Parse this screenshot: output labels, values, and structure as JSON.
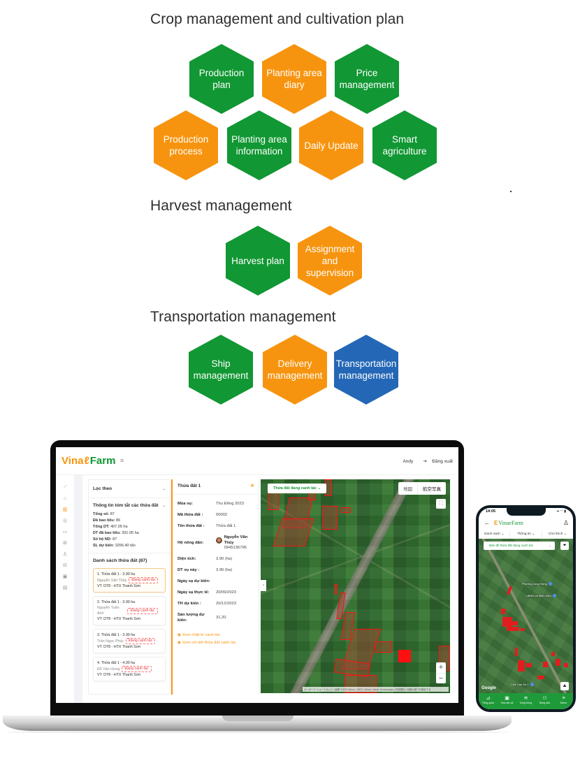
{
  "sections": [
    {
      "title": "Crop management and cultivation plan",
      "features": [
        {
          "label": "Production plan",
          "color": "green"
        },
        {
          "label": "Planting area diary",
          "color": "orange"
        },
        {
          "label": "Price management",
          "color": "green"
        },
        {
          "label": "Production process",
          "color": "orange"
        },
        {
          "label": "Planting area information",
          "color": "green"
        },
        {
          "label": "Daily Update",
          "color": "orange"
        },
        {
          "label": "Smart agriculture",
          "color": "green"
        }
      ]
    },
    {
      "title": "Harvest management",
      "features": [
        {
          "label": "Harvest plan",
          "color": "green"
        },
        {
          "label": "Assignment and supervision",
          "color": "orange"
        }
      ]
    },
    {
      "title": "Transportation management",
      "features": [
        {
          "label": "Ship management",
          "color": "green"
        },
        {
          "label": "Delivery management",
          "color": "orange"
        },
        {
          "label": "Transportation management",
          "color": "blue"
        }
      ]
    }
  ],
  "colors": {
    "green": "#119733",
    "orange": "#f7940f",
    "blue": "#2467b6",
    "alert_red": "#e8323a"
  },
  "laptop_app": {
    "logo": {
      "part1": "Vina",
      "part2": "Farm"
    },
    "menu_icon": "hamburger-icon",
    "user": {
      "name": "Andy",
      "logout": "Đăng xuất",
      "logout_icon": "logout-icon"
    },
    "rail_icons": [
      "chart-line-icon",
      "home-icon",
      "map-icon",
      "layers-icon",
      "briefcase-icon",
      "grid-icon",
      "users-icon",
      "apps-icon",
      "calendar-icon",
      "document-icon"
    ],
    "filter": {
      "label": "Lọc theo"
    },
    "summary": {
      "title": "Thông tin tóm tắt các thửa đất",
      "stats": [
        {
          "label": "Tổng số:",
          "value": "87"
        },
        {
          "label": "Đã bao tiêu:",
          "value": "86"
        },
        {
          "label": "Tổng DT:",
          "value": "407.05 ha"
        },
        {
          "label": "DT đã bao tiêu:",
          "value": "391.05 ha"
        },
        {
          "label": "Số hộ ND:",
          "value": "87"
        },
        {
          "label": "SL dự kiến:",
          "value": "3256.40 tấn"
        }
      ]
    },
    "plot_list": {
      "title": "Danh sách thửa đất (87)",
      "items": [
        {
          "title": "1. Thửa đất 1 - 3.90 ha",
          "owner": "Nguyễn Văn Thủy",
          "status": "Đang canh tác",
          "location": "VT: DT8 - HTX Thanh Sơn"
        },
        {
          "title": "2. Thửa đất 1 - 3.90 ha",
          "owner": "Nguyễn Tuấn Anh",
          "status": "Đang canh tác",
          "location": "VT: DT8 - HTX Thanh Sơn"
        },
        {
          "title": "3. Thửa đất 1 - 3.30 ha",
          "owner": "Trần Ngọc Phúc",
          "status": "Đang canh tác",
          "location": "VT: DT8 - HTX Thanh Sơn"
        },
        {
          "title": "4. Thửa đất 1 - 4.00 ha",
          "owner": "Đỗ Văn Hưng",
          "status": "Đang canh tác",
          "location": "VT: DT8 - HTX Thanh Sơn"
        }
      ]
    },
    "detail": {
      "title": "Thửa đất 1",
      "fields": [
        {
          "label": "Mùa vụ:",
          "value": "Thu Đông 2023"
        },
        {
          "label": "Mã thửa đất :",
          "value": "00002"
        },
        {
          "label": "Tên thửa đất :",
          "value": "Thửa đất 1"
        }
      ],
      "farmer": {
        "label": "Hộ nông dân:",
        "name": "Nguyễn Văn Thủy",
        "phone": "0945136796"
      },
      "fields2": [
        {
          "label": "Diện tích:",
          "value": "3.90 (ha)"
        },
        {
          "label": "DT vụ này :",
          "value": "3.90 (ha)"
        },
        {
          "label": "Ngày sạ dự kiến:",
          "value": ""
        },
        {
          "label": "Ngày sạ thực tế:",
          "value": "20/09/2023"
        },
        {
          "label": "TH dự kiến :",
          "value": "20/12/2023"
        },
        {
          "label": "Sản lượng dự kiến:",
          "value": "31.20"
        }
      ],
      "links": [
        "Xem nhật kí canh tác",
        "Xem chi tiết thửa đất canh tác"
      ]
    },
    "map": {
      "filter_label": "Thửa đất đang canh tác",
      "map_types": [
        "地図",
        "航空写真"
      ],
      "zoom_in": "+",
      "zoom_out": "−",
      "attribution": "キーボード ショートカット | 画像 ©2023 Airbus, CNES / Airbus, Maxar Technologies | 利用規約 | 地図の誤りを報告する"
    }
  },
  "phone_app": {
    "time": "14:05",
    "signal": "▪▪ ◠ ▮",
    "logo": "VinaeFarm",
    "tabs": [
      "Danh sách ⌄",
      "Thông tin ⌄",
      "Chú thích ⌄"
    ],
    "map_filter": "Bản đồ thửa đất đang canh tác",
    "pois": [
      "Phường Long Hưng",
      "UBND xã Minh Diệu",
      "Chợ Cầu Số 2"
    ],
    "google": "Google",
    "nav": [
      {
        "label": "Tổng quan",
        "icon": "chart-icon"
      },
      {
        "label": "Hợp tác xã",
        "icon": "briefcase-icon"
      },
      {
        "label": "Vùng trồng",
        "icon": "layers-icon"
      },
      {
        "label": "Nông dân",
        "icon": "users-icon"
      },
      {
        "label": "Menu",
        "icon": "menu-icon"
      }
    ]
  }
}
